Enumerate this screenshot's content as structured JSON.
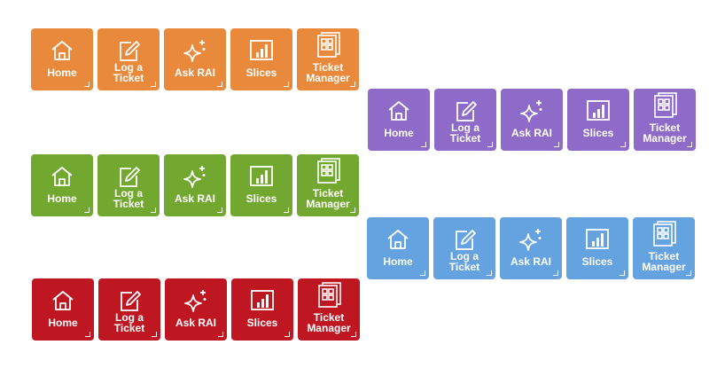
{
  "labels": {
    "home": "Home",
    "log_ticket": "Log a\nTicket",
    "ask": "Ask RAI",
    "slices": "Slices",
    "ticket_manager": "Ticket\nManager"
  },
  "colors": {
    "orange": "#E8893C",
    "purple": "#8E6BC8",
    "green": "#72A82F",
    "blue": "#64A3DF",
    "red": "#BE1722"
  },
  "icons": {
    "home": "home-icon",
    "log_ticket": "edit-ticket-icon",
    "ask": "sparkle-icon",
    "slices": "bar-chart-icon",
    "ticket_manager": "grid-stack-icon"
  }
}
